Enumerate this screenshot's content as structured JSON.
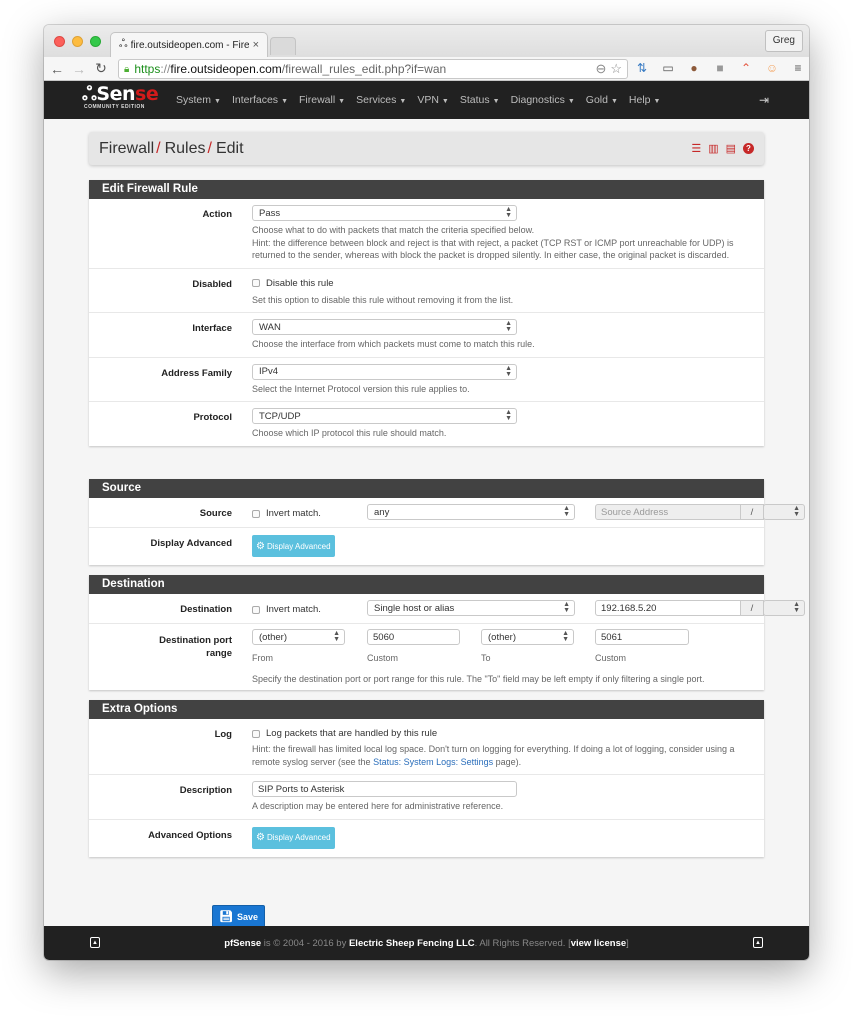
{
  "browser": {
    "tab_title": "fire.outsideopen.com - Fire",
    "tab_favicon": "pfsense-logo-icon",
    "profile_name": "Greg",
    "url": {
      "scheme": "https",
      "separator": "://",
      "host": "fire.outsideopen.com",
      "path": "/firewall_rules_edit.php?if=wan"
    }
  },
  "nav": {
    "logo_text_a": "Sen",
    "logo_text_b": "se",
    "logo_sub": "COMMUNITY EDITION",
    "menu": [
      "System",
      "Interfaces",
      "Firewall",
      "Services",
      "VPN",
      "Status",
      "Diagnostics",
      "Gold",
      "Help"
    ]
  },
  "breadcrumb": {
    "items": [
      "Firewall",
      "Rules",
      "Edit"
    ],
    "separator": "/",
    "icons": [
      "sliders-icon",
      "bar-chart-icon",
      "list-icon",
      "help-icon"
    ]
  },
  "edit_rule": {
    "heading": "Edit Firewall Rule",
    "action": {
      "label": "Action",
      "value": "Pass",
      "help_1": "Choose what to do with packets that match the criteria specified below.",
      "help_2": "Hint: the difference between block and reject is that with reject, a packet (TCP RST or ICMP port unreachable for UDP) is returned to the sender, whereas with block the packet is dropped silently. In either case, the original packet is discarded."
    },
    "disabled": {
      "label": "Disabled",
      "checkbox_label": "Disable this rule",
      "checked": false,
      "help": "Set this option to disable this rule without removing it from the list."
    },
    "interface": {
      "label": "Interface",
      "value": "WAN",
      "help": "Choose the interface from which packets must come to match this rule."
    },
    "address_family": {
      "label": "Address Family",
      "value": "IPv4",
      "help": "Select the Internet Protocol version this rule applies to."
    },
    "protocol": {
      "label": "Protocol",
      "value": "TCP/UDP",
      "help": "Choose which IP protocol this rule should match."
    }
  },
  "source": {
    "heading": "Source",
    "label": "Source",
    "invert_label": "Invert match.",
    "invert_checked": false,
    "type_value": "any",
    "address_placeholder": "Source Address",
    "mask_sep": "/",
    "mask_value": "",
    "advanced_label": "Display Advanced",
    "advanced_button": "Display Advanced"
  },
  "destination": {
    "heading": "Destination",
    "label": "Destination",
    "invert_label": "Invert match.",
    "invert_checked": false,
    "type_value": "Single host or alias",
    "address_value": "192.168.5.20",
    "mask_sep": "/",
    "mask_value": "",
    "port_label_1": "Destination port",
    "port_label_2": "range",
    "from_select": "(other)",
    "from_custom": "5060",
    "to_select": "(other)",
    "to_custom": "5061",
    "from_caption": "From",
    "custom_caption": "Custom",
    "to_caption": "To",
    "port_help": "Specify the destination port or port range for this rule. The \"To\" field may be left empty if only filtering a single port."
  },
  "extra": {
    "heading": "Extra Options",
    "log_label": "Log",
    "log_checkbox_label": "Log packets that are handled by this rule",
    "log_checked": false,
    "log_help_pre": "Hint: the firewall has limited local log space. Don't turn on logging for everything. If doing a lot of logging, consider using a remote syslog server (see the ",
    "log_help_link": "Status: System Logs: Settings",
    "log_help_post": " page).",
    "description_label": "Description",
    "description_value": "SIP Ports to Asterisk",
    "description_help": "A description may be entered here for administrative reference.",
    "advanced_label": "Advanced Options",
    "advanced_button": "Display Advanced"
  },
  "save_button": "Save",
  "footer": {
    "brand": "pfSense",
    "text_1": " is © 2004 - 2016 by ",
    "company": "Electric Sheep Fencing LLC",
    "text_2": ". All Rights Reserved. [",
    "license_link": "view license",
    "text_3": "]"
  },
  "colors": {
    "accent_red": "#c62828",
    "nav_bg": "#212121",
    "panel_heading_bg": "#424242",
    "info_button": "#5bc0de",
    "save_button": "#1976d2",
    "link": "#2a6ebb"
  }
}
